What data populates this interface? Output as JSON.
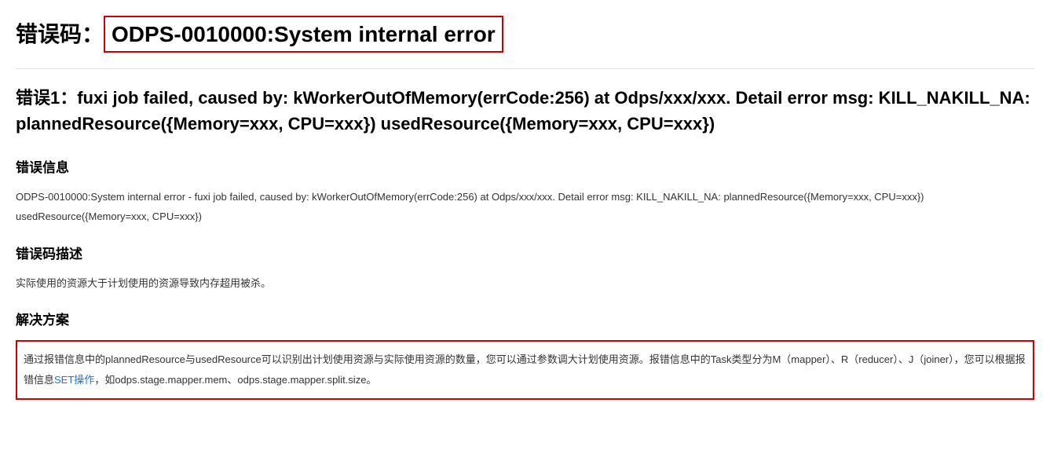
{
  "header": {
    "prefix": "错误码：",
    "code": "ODPS-0010000:System internal error"
  },
  "error": {
    "title": "错误1：fuxi job failed, caused by: kWorkerOutOfMemory(errCode:256) at Odps/xxx/xxx. Detail error msg: KILL_NAKILL_NA: plannedResource({Memory=xxx, CPU=xxx}) usedResource({Memory=xxx, CPU=xxx})"
  },
  "sections": {
    "errorInfo": {
      "heading": "错误信息",
      "text": "ODPS-0010000:System internal error - fuxi job failed, caused by: kWorkerOutOfMemory(errCode:256) at Odps/xxx/xxx. Detail error msg: KILL_NAKILL_NA: plannedResource({Memory=xxx, CPU=xxx}) usedResource({Memory=xxx, CPU=xxx})"
    },
    "description": {
      "heading": "错误码描述",
      "text": "实际使用的资源大于计划使用的资源导致内存超用被杀。"
    },
    "solution": {
      "heading": "解决方案",
      "textBefore": "通过报错信息中的plannedResource与usedResource可以识别出计划使用资源与实际使用资源的数量，您可以通过参数调大计划使用资源。报错信息中的Task类型分为M（mapper）、R（reducer）、J（joiner），您可以根据报错信息",
      "linkText": "SET操作",
      "textAfter": "，如odps.stage.mapper.mem、odps.stage.mapper.split.size。"
    }
  }
}
